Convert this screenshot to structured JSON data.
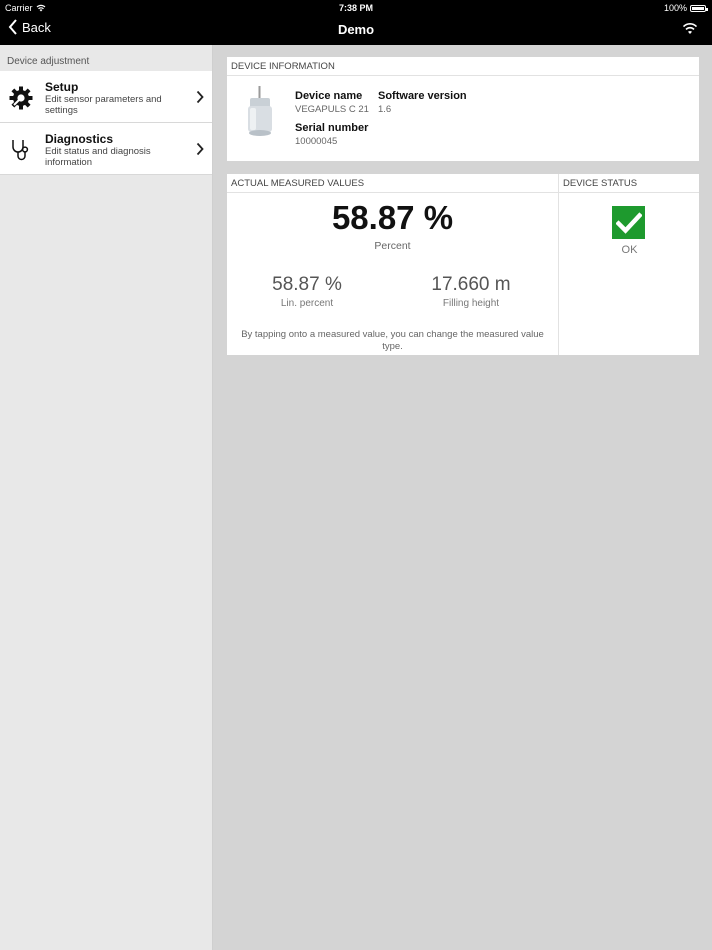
{
  "status_bar": {
    "carrier": "Carrier",
    "time": "7:38 PM",
    "battery": "100%"
  },
  "nav": {
    "back_label": "Back",
    "title": "Demo"
  },
  "sidebar": {
    "header": "Device adjustment",
    "items": [
      {
        "title": "Setup",
        "subtitle": "Edit sensor parameters and settings"
      },
      {
        "title": "Diagnostics",
        "subtitle": "Edit status and diagnosis information"
      }
    ]
  },
  "device_info": {
    "header": "DEVICE INFORMATION",
    "device_name_label": "Device name",
    "device_name": "VEGAPULS C 21",
    "software_label": "Software version",
    "software_version": "1.6",
    "serial_label": "Serial number",
    "serial_number": "10000045"
  },
  "measured": {
    "header": "ACTUAL MEASURED VALUES",
    "primary_value": "58.87 %",
    "primary_unit": "Percent",
    "secondary": [
      {
        "value": "58.87 %",
        "unit": "Lin. percent"
      },
      {
        "value": "17.660 m",
        "unit": "Filling height"
      }
    ],
    "hint": "By tapping onto a measured value, you can change the measured value type."
  },
  "device_status": {
    "header": "DEVICE STATUS",
    "status": "OK",
    "status_color": "#1e9a2e"
  }
}
